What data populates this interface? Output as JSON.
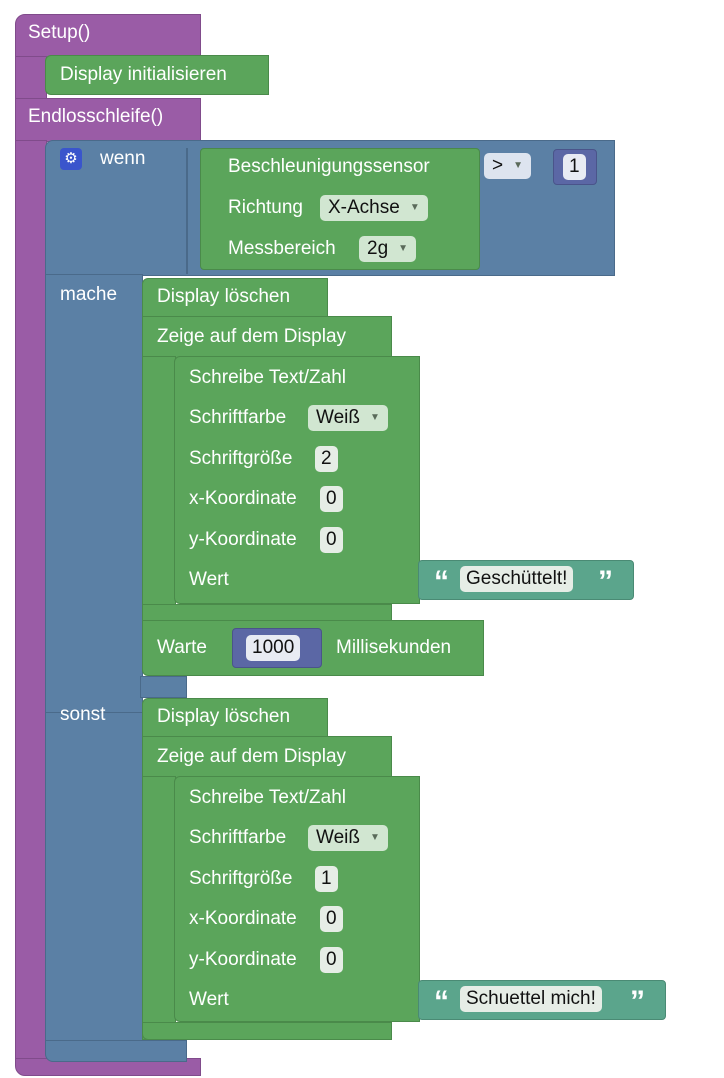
{
  "setup": {
    "label": "Setup()",
    "display_init": "Display initialisieren"
  },
  "loop": {
    "label": "Endlosschleife()"
  },
  "if_block": {
    "wenn": "wenn",
    "mache": "mache",
    "sonst": "sonst",
    "condition": {
      "sensor": "Beschleunigungssensor",
      "richtung_label": "Richtung",
      "richtung_value": "X-Achse",
      "messbereich_label": "Messbereich",
      "messbereich_value": "2g",
      "operator": ">",
      "compare_value": "1"
    }
  },
  "then_branch": {
    "clear": "Display löschen",
    "show": "Zeige auf dem Display",
    "write": {
      "title": "Schreibe Text/Zahl",
      "color_label": "Schriftfarbe",
      "color_value": "Weiß",
      "size_label": "Schriftgröße",
      "size_value": "2",
      "x_label": "x-Koordinate",
      "x_value": "0",
      "y_label": "y-Koordinate",
      "y_value": "0",
      "value_label": "Wert",
      "text": "Geschüttelt!"
    },
    "wait": {
      "label": "Warte",
      "value": "1000",
      "unit": "Millisekunden"
    }
  },
  "else_branch": {
    "clear": "Display löschen",
    "show": "Zeige auf dem Display",
    "write": {
      "title": "Schreibe Text/Zahl",
      "color_label": "Schriftfarbe",
      "color_value": "Weiß",
      "size_label": "Schriftgröße",
      "size_value": "1",
      "x_label": "x-Koordinate",
      "x_value": "0",
      "y_label": "y-Koordinate",
      "y_value": "0",
      "value_label": "Wert",
      "text": "Schuettel mich!"
    }
  },
  "icons": {
    "settings": "gear-icon",
    "dropdown": "dropdown-arrow-icon",
    "quote_open": "quote-open-icon",
    "quote_close": "quote-close-icon"
  },
  "colors": {
    "procedure": "#9a5ca6",
    "logic": "#5b80a5",
    "display": "#5ba55b",
    "text": "#5ba58c",
    "math": "#5b67a5"
  }
}
